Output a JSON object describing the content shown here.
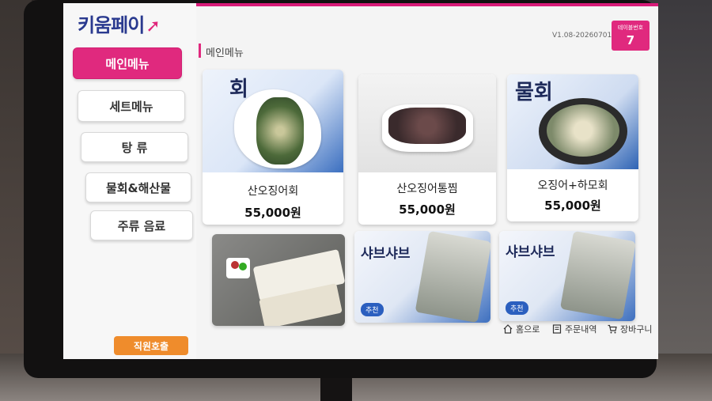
{
  "app": {
    "logo_text": "키움페이",
    "logo_mark": "K"
  },
  "sidebar": {
    "items": [
      {
        "label": "메인메뉴",
        "active": true
      },
      {
        "label": "세트메뉴",
        "active": false
      },
      {
        "label": "탕 류",
        "active": false
      },
      {
        "label": "물회&해산물",
        "active": false
      },
      {
        "label": "주류 음료",
        "active": false
      }
    ],
    "staff_call_label": "직원호출"
  },
  "header": {
    "section_title": "메인메뉴",
    "version": "V1.08-20260701.1.105",
    "table_label": "테이블번호",
    "table_number": "7"
  },
  "products": [
    {
      "name": "산오징어회",
      "price": "55,000원",
      "photo_title": "회"
    },
    {
      "name": "산오징어통찜",
      "price": "55,000원",
      "photo_title": ""
    },
    {
      "name": "오징어+하모회",
      "price": "55,000원",
      "photo_title": "물회"
    },
    {
      "photo_title": ""
    },
    {
      "photo_title": "샤브샤브",
      "badge": "추천"
    },
    {
      "photo_title": "샤브샤브",
      "badge": "추천"
    }
  ],
  "bottom_nav": {
    "home_label": "홈으로",
    "orders_label": "주문내역",
    "cart_label": "장바구니"
  },
  "colors": {
    "accent": "#e0297e",
    "staff_button": "#ef8c2c",
    "logo_text": "#2a3a8f"
  }
}
